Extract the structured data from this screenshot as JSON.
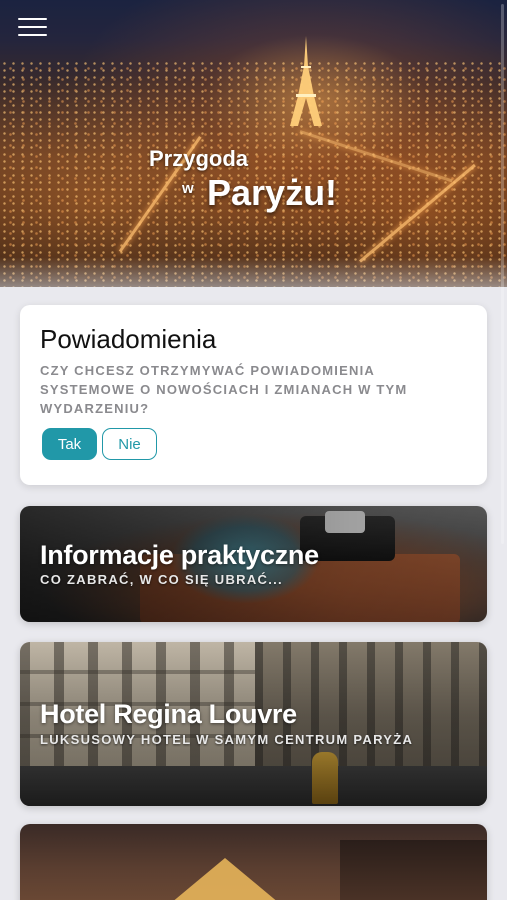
{
  "hero": {
    "title_line1": "Przygoda",
    "title_w": "w",
    "title_line2": "Paryżu!"
  },
  "menu": {
    "icon": "hamburger-menu-icon"
  },
  "notifications": {
    "title": "Powiadomienia",
    "question": "Czy chcesz otrzymywać powiadomienia systemowe o nowościach i zmianach w tym wydarzeniu?",
    "yes_label": "Tak",
    "no_label": "Nie"
  },
  "cards": [
    {
      "title": "Informacje praktyczne",
      "subtitle": "Co zabrać, w co się ubrać..."
    },
    {
      "title": "Hotel Regina Louvre",
      "subtitle": "Luksusowy hotel w samym centrum Paryża"
    },
    {
      "title": "",
      "subtitle": ""
    }
  ],
  "colors": {
    "accent": "#2198a8",
    "background": "#e9e9ee",
    "card_bg": "#ffffff",
    "muted_text": "#8a8a8e"
  }
}
